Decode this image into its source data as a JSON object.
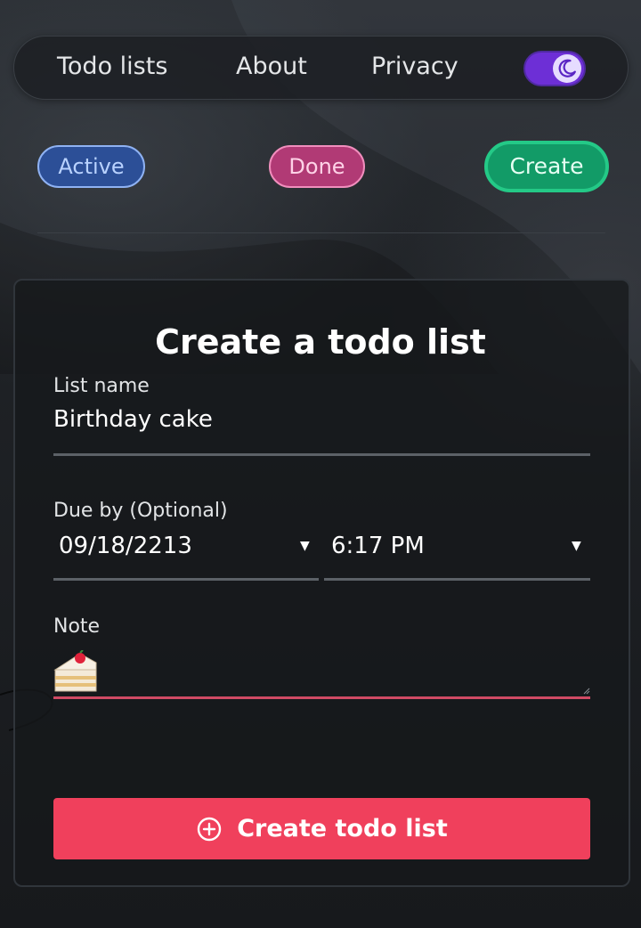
{
  "nav": {
    "links": [
      "Todo lists",
      "About",
      "Privacy"
    ],
    "theme_toggle": {
      "state": "dark",
      "icon": "moon-icon"
    }
  },
  "filters": {
    "active": "Active",
    "done": "Done",
    "create": "Create"
  },
  "form": {
    "title": "Create a todo list",
    "list_name_label": "List name",
    "list_name_value": "Birthday cake",
    "due_label": "Due by (Optional)",
    "due_date": "09/18/2213",
    "due_time": "6:17 PM",
    "note_label": "Note",
    "note_value_icon": "cake-emoji",
    "submit_label": "Create todo list",
    "submit_icon": "plus-circle-icon"
  },
  "colors": {
    "accent": "#f0405c",
    "toggle": "#6d2fd6",
    "chip_active": "#2c4f97",
    "chip_done": "#b13a75",
    "chip_create": "#129b67",
    "note_underline": "#d04a64"
  }
}
